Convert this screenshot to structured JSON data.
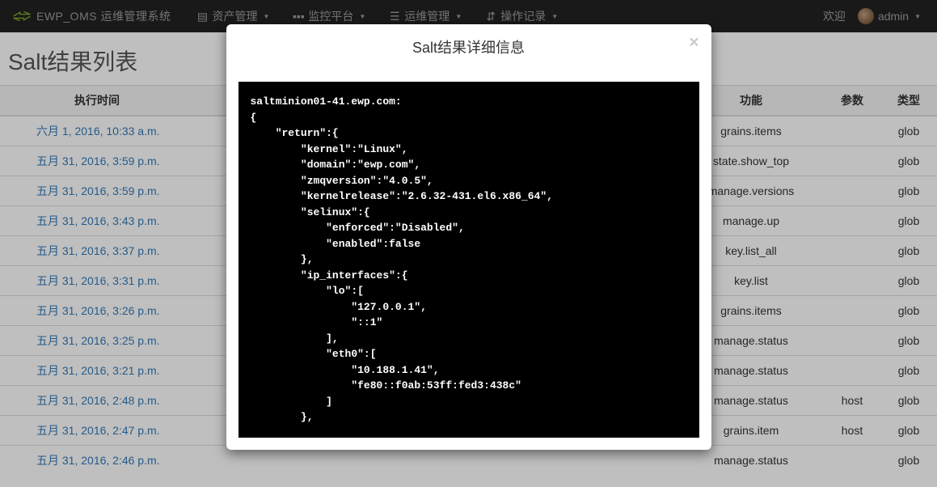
{
  "nav": {
    "brand": "EWP_OMS 运维管理系统",
    "items": [
      {
        "label": "资产管理"
      },
      {
        "label": "监控平台"
      },
      {
        "label": "运维管理"
      },
      {
        "label": "操作记录"
      }
    ],
    "welcome": "欢迎",
    "user": "admin"
  },
  "page_title": "Salt结果列表",
  "table": {
    "headers": {
      "time": "执行时间",
      "func": "功能",
      "param": "参数",
      "kind": "类型"
    },
    "rows": [
      {
        "time": "六月 1, 2016, 10:33 a.m.",
        "func": "grains.items",
        "param": "",
        "kind": "glob"
      },
      {
        "time": "五月 31, 2016, 3:59 p.m.",
        "func": "state.show_top",
        "param": "",
        "kind": "glob"
      },
      {
        "time": "五月 31, 2016, 3:59 p.m.",
        "func": "manage.versions",
        "param": "",
        "kind": "glob"
      },
      {
        "time": "五月 31, 2016, 3:43 p.m.",
        "func": "manage.up",
        "param": "",
        "kind": "glob"
      },
      {
        "time": "五月 31, 2016, 3:37 p.m.",
        "func": "key.list_all",
        "param": "",
        "kind": "glob"
      },
      {
        "time": "五月 31, 2016, 3:31 p.m.",
        "func": "key.list",
        "param": "",
        "kind": "glob"
      },
      {
        "time": "五月 31, 2016, 3:26 p.m.",
        "func": "grains.items",
        "param": "",
        "kind": "glob"
      },
      {
        "time": "五月 31, 2016, 3:25 p.m.",
        "func": "manage.status",
        "param": "",
        "kind": "glob"
      },
      {
        "time": "五月 31, 2016, 3:21 p.m.",
        "func": "manage.status",
        "param": "",
        "kind": "glob"
      },
      {
        "time": "五月 31, 2016, 2:48 p.m.",
        "func": "manage.status",
        "param": "host",
        "kind": "glob"
      },
      {
        "time": "五月 31, 2016, 2:47 p.m.",
        "func": "grains.item",
        "param": "host",
        "kind": "glob"
      },
      {
        "time": "五月 31, 2016, 2:46 p.m.",
        "func": "manage.status",
        "param": "",
        "kind": "glob"
      }
    ]
  },
  "modal": {
    "title": "Salt结果详细信息",
    "close": "×",
    "code": "saltminion01-41.ewp.com:\n{\n    \"return\":{\n        \"kernel\":\"Linux\",\n        \"domain\":\"ewp.com\",\n        \"zmqversion\":\"4.0.5\",\n        \"kernelrelease\":\"2.6.32-431.el6.x86_64\",\n        \"selinux\":{\n            \"enforced\":\"Disabled\",\n            \"enabled\":false\n        },\n        \"ip_interfaces\":{\n            \"lo\":[\n                \"127.0.0.1\",\n                \"::1\"\n            ],\n            \"eth0\":[\n                \"10.188.1.41\",\n                \"fe80::f0ab:53ff:fed3:438c\"\n            ]\n        },\n"
  }
}
